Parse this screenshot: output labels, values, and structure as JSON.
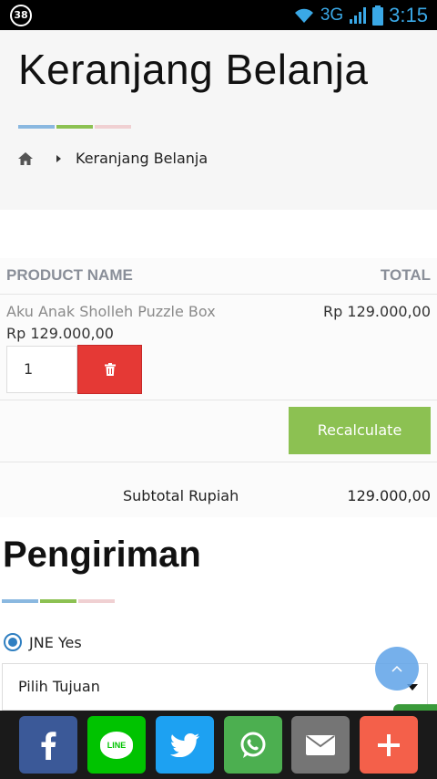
{
  "status_bar": {
    "notification_count": "38",
    "network": "3G",
    "time": "3:15"
  },
  "header": {
    "title": "Keranjang Belanja",
    "breadcrumb": {
      "home_icon": "home-icon",
      "current": "Keranjang Belanja"
    }
  },
  "cart": {
    "columns": {
      "product": "PRODUCT NAME",
      "total": "TOTAL"
    },
    "items": [
      {
        "name": "Aku Anak Sholleh Puzzle Box",
        "price": "Rp 129.000,00",
        "total": "Rp 129.000,00",
        "quantity": "1"
      }
    ],
    "recalculate_label": "Recalculate",
    "subtotal_label": "Subtotal Rupiah",
    "subtotal_value": "129.000,00"
  },
  "shipping": {
    "title": "Pengiriman",
    "option_label": "JNE Yes",
    "destination_placeholder": "Pilih Tujuan"
  },
  "share_bar": {
    "buttons": [
      {
        "name": "facebook",
        "icon": "facebook-icon",
        "color": "#3b5998"
      },
      {
        "name": "line",
        "icon": "line-icon",
        "text": "LINE",
        "color": "#00c300"
      },
      {
        "name": "twitter",
        "icon": "twitter-icon",
        "color": "#1da1f2"
      },
      {
        "name": "whatsapp",
        "icon": "whatsapp-icon",
        "color": "#4caf50"
      },
      {
        "name": "email",
        "icon": "email-icon",
        "color": "#757575"
      },
      {
        "name": "more",
        "icon": "plus-icon",
        "color": "#f4604a"
      }
    ]
  },
  "colors": {
    "accent_green": "#8cc152",
    "delete_red": "#e53935",
    "link_blue": "#2f7fc1"
  }
}
